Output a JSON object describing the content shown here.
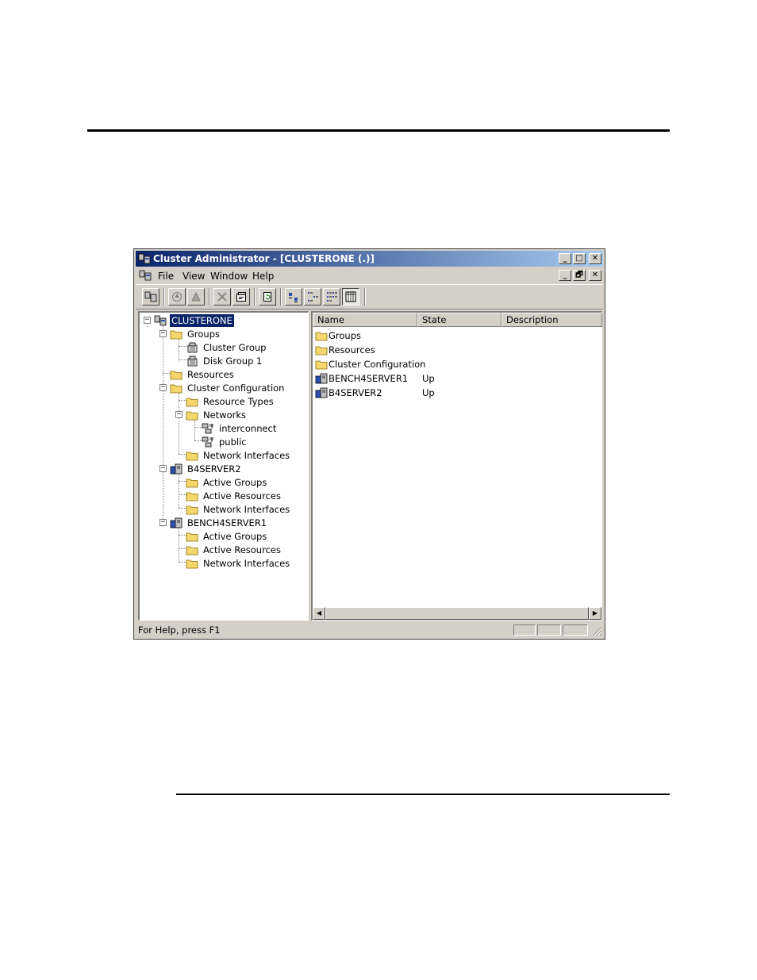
{
  "window": {
    "title": "Cluster Administrator - [CLUSTERONE (.)]",
    "caption_buttons": [
      "_",
      "□",
      "✕"
    ],
    "mdi_buttons": [
      "_",
      "🗗",
      "✕"
    ]
  },
  "menu": [
    "File",
    "View",
    "Window",
    "Help"
  ],
  "toolbar": {
    "buttons": [
      "open-connection",
      "bring-online",
      "take-offline",
      "delete",
      "properties",
      "refresh",
      "large-icons",
      "small-icons",
      "list-view",
      "details-view"
    ]
  },
  "tree": [
    {
      "label": "CLUSTERONE",
      "icon": "cluster-icon",
      "selected": true
    },
    {
      "label": "Groups",
      "icon": "folder-icon"
    },
    {
      "label": "Cluster Group",
      "icon": "group-icon"
    },
    {
      "label": "Disk Group 1",
      "icon": "group-icon"
    },
    {
      "label": "Resources",
      "icon": "folder-icon"
    },
    {
      "label": "Cluster Configuration",
      "icon": "folder-icon"
    },
    {
      "label": "Resource Types",
      "icon": "folder-icon"
    },
    {
      "label": "Networks",
      "icon": "folder-icon"
    },
    {
      "label": "interconnect",
      "icon": "network-icon"
    },
    {
      "label": "public",
      "icon": "network-icon"
    },
    {
      "label": "Network Interfaces",
      "icon": "folder-icon"
    },
    {
      "label": "B4SERVER2",
      "icon": "server-icon"
    },
    {
      "label": "Active Groups",
      "icon": "folder-icon"
    },
    {
      "label": "Active Resources",
      "icon": "folder-icon"
    },
    {
      "label": "Network Interfaces",
      "icon": "folder-icon"
    },
    {
      "label": "BENCH4SERVER1",
      "icon": "server-icon"
    },
    {
      "label": "Active Groups",
      "icon": "folder-icon"
    },
    {
      "label": "Active Resources",
      "icon": "folder-icon"
    },
    {
      "label": "Network Interfaces",
      "icon": "folder-icon"
    }
  ],
  "list": {
    "columns": [
      "Name",
      "State",
      "Description"
    ],
    "rows": [
      {
        "name": "Groups",
        "state": "",
        "description": "",
        "icon": "folder-icon"
      },
      {
        "name": "Resources",
        "state": "",
        "description": "",
        "icon": "folder-icon"
      },
      {
        "name": "Cluster Configuration",
        "state": "",
        "description": "",
        "icon": "folder-icon"
      },
      {
        "name": "BENCH4SERVER1",
        "state": "Up",
        "description": "",
        "icon": "server-icon"
      },
      {
        "name": "B4SERVER2",
        "state": "Up",
        "description": "",
        "icon": "server-icon"
      }
    ]
  },
  "status": {
    "text": "For Help, press F1"
  },
  "colors": {
    "titlebar_start": "#0a246a",
    "titlebar_end": "#a6caf0",
    "folder": "#f5d76e",
    "selection": "#0a246a"
  }
}
